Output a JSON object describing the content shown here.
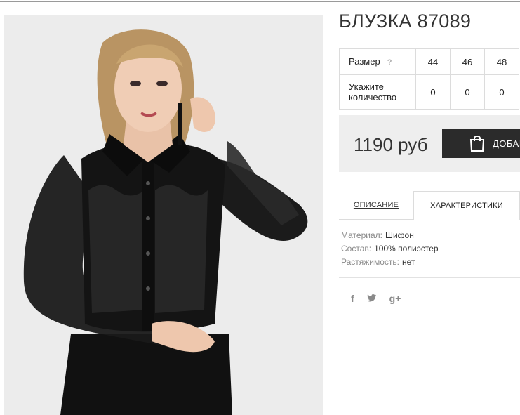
{
  "product": {
    "title": "БЛУЗКА 87089",
    "image_alt": "photo-woman-black-blouse"
  },
  "sizes": {
    "size_label": "Размер",
    "help_label": "?",
    "qty_label_line1": "Укажите",
    "qty_label_line2": "количество",
    "values": [
      "44",
      "46",
      "48"
    ],
    "quantities": [
      "0",
      "0",
      "0"
    ]
  },
  "purchase": {
    "price": "1190 руб",
    "add_button_label": "ДОБАВ",
    "bag_icon": "shopping-bag-icon"
  },
  "tabs": {
    "description": "ОПИСАНИЕ",
    "characteristics": "ХАРАКТЕРИСТИКИ",
    "active": "characteristics"
  },
  "properties": [
    {
      "key": "Материал:",
      "value": "Шифон"
    },
    {
      "key": "Состав:",
      "value": "100% полиэстер"
    },
    {
      "key": "Растяжимость:",
      "value": "нет"
    }
  ],
  "social": {
    "facebook": "f",
    "twitter": "twitter-bird-icon",
    "google_plus": "g+"
  },
  "colors": {
    "button_bg": "#2b2b2b",
    "price_box_bg": "#eeeeee",
    "photo_bg": "#ececec"
  }
}
